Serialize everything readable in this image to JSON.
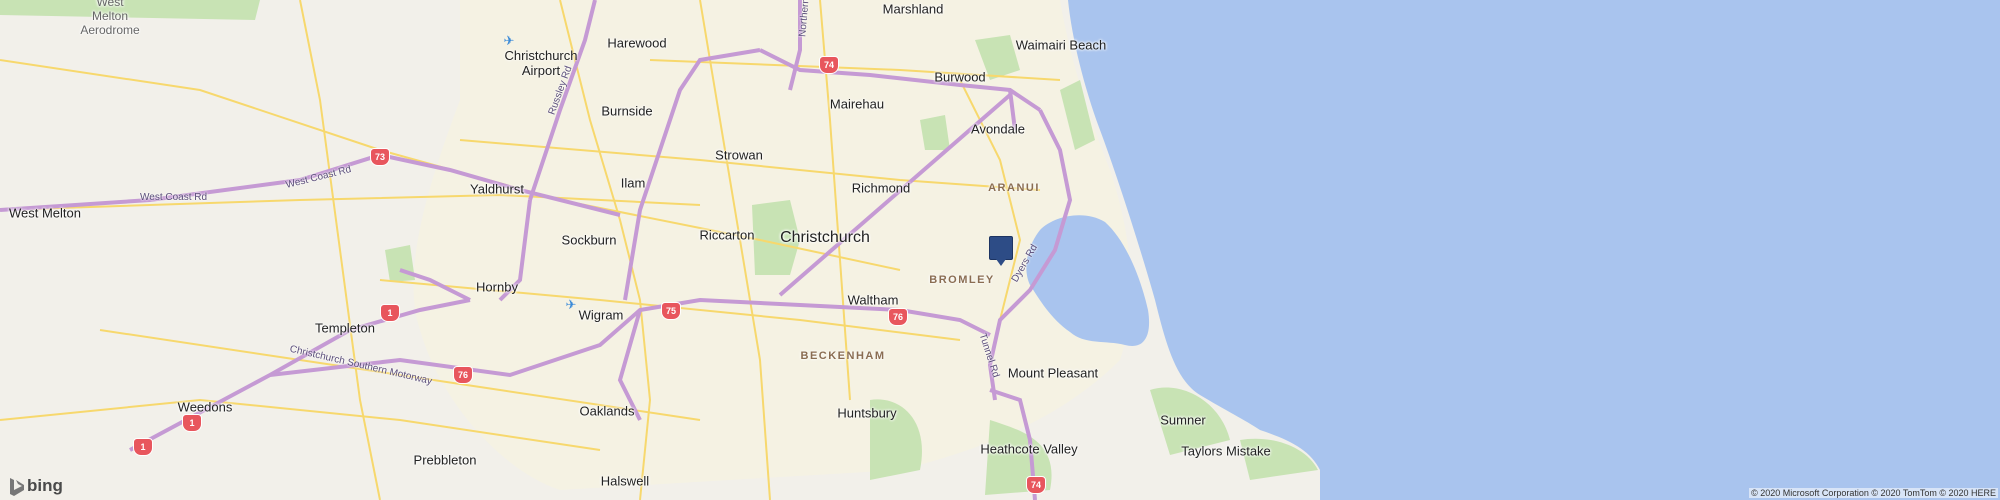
{
  "map": {
    "places": [
      {
        "id": "west-melton-aerodrome",
        "label_line1": "West",
        "label_line2": "Melton",
        "label_line3": "Aerodrome"
      },
      {
        "id": "harewood",
        "label": "Harewood"
      },
      {
        "id": "marshland",
        "label": "Marshland"
      },
      {
        "id": "waimairi-beach",
        "label": "Waimairi Beach"
      },
      {
        "id": "burwood",
        "label": "Burwood"
      },
      {
        "id": "mairehau",
        "label": "Mairehau"
      },
      {
        "id": "burnside",
        "label": "Burnside"
      },
      {
        "id": "avondale",
        "label": "Avondale"
      },
      {
        "id": "strowan",
        "label": "Strowan"
      },
      {
        "id": "ilam",
        "label": "Ilam"
      },
      {
        "id": "richmond",
        "label": "Richmond"
      },
      {
        "id": "yaldhurst",
        "label": "Yaldhurst"
      },
      {
        "id": "west-melton",
        "label": "West Melton"
      },
      {
        "id": "riccarton",
        "label": "Riccarton"
      },
      {
        "id": "christchurch",
        "label": "Christchurch"
      },
      {
        "id": "sockburn",
        "label": "Sockburn"
      },
      {
        "id": "hornby",
        "label": "Hornby"
      },
      {
        "id": "wigram",
        "label": "Wigram"
      },
      {
        "id": "waltham",
        "label": "Waltham"
      },
      {
        "id": "templeton",
        "label": "Templeton"
      },
      {
        "id": "mount-pleasant",
        "label": "Mount Pleasant"
      },
      {
        "id": "weedons",
        "label": "Weedons"
      },
      {
        "id": "oaklands",
        "label": "Oaklands"
      },
      {
        "id": "huntsbury",
        "label": "Huntsbury"
      },
      {
        "id": "sumner",
        "label": "Sumner"
      },
      {
        "id": "heathcote-valley",
        "label": "Heathcote Valley"
      },
      {
        "id": "taylors-mistake",
        "label": "Taylors Mistake"
      },
      {
        "id": "prebbleton",
        "label": "Prebbleton"
      },
      {
        "id": "halswell",
        "label": "Halswell"
      }
    ],
    "airport": {
      "line1": "Christchurch",
      "line2": "Airport"
    },
    "suburbs": [
      "ARANUI",
      "BROMLEY",
      "BECKENHAM"
    ],
    "roads": [
      "Russley Rd",
      "West Coast Rd",
      "West Coast Rd",
      "Christchurch Southern Motorway",
      "Dyers Rd",
      "Tunnel Rd",
      "Northern"
    ],
    "shields": [
      "74",
      "73",
      "75",
      "76",
      "1",
      "76",
      "1",
      "1",
      "74"
    ],
    "pin": {
      "label": "Selected location"
    },
    "logo": {
      "text": "bing"
    },
    "copyright": "© 2020 Microsoft Corporation © 2020 TomTom © 2020 HERE",
    "colors": {
      "water": "#a9c4ee",
      "land": "#f2f0ea",
      "urban": "#f5f2e3",
      "park": "#c8e3b4",
      "motorway": "#c59ad4",
      "arterial": "#f7d86d",
      "pin": "#2d4c86"
    }
  }
}
